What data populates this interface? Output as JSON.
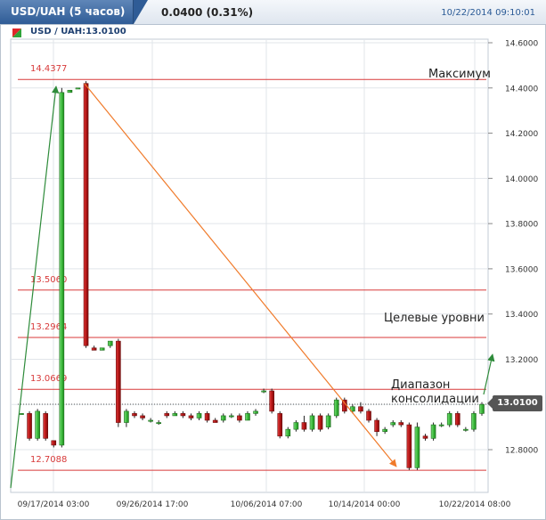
{
  "header": {
    "tab_label": "USD/UAH (5 часов)",
    "change": "0.0400 (0.31%)",
    "datetime": "10/22/2014 09:10:01"
  },
  "chart_data": {
    "type": "candlestick",
    "subtitle": "USD / UAH:13.0100",
    "last_price": "13.0100",
    "ylim": [
      12.68,
      14.68
    ],
    "y_ticks": [
      "12.8000",
      "13.0000",
      "13.2000",
      "13.4000",
      "13.6000",
      "13.8000",
      "14.0000",
      "14.2000",
      "14.4000",
      "14.6000"
    ],
    "x_ticks": [
      "09/17/2014 03:00",
      "09/26/2014 17:00",
      "10/06/2014 07:00",
      "10/14/2014 00:00",
      "10/22/2014 08:00"
    ],
    "levels": [
      {
        "label": "14.4377",
        "value": 14.4377
      },
      {
        "label": "13.5060",
        "value": 13.506
      },
      {
        "label": "13.2964",
        "value": 13.2964
      },
      {
        "label": "13.0669",
        "value": 13.0669
      },
      {
        "label": "12.7088",
        "value": 12.7088
      }
    ],
    "annotations": {
      "max": "Максимум",
      "targets": "Целевые уровни",
      "range_line1": "Диапазон",
      "range_line2": "консолидации"
    },
    "candles": [
      [
        12.96,
        12.96,
        12.96,
        12.96
      ],
      [
        12.96,
        12.97,
        12.84,
        12.85
      ],
      [
        12.85,
        12.98,
        12.84,
        12.97
      ],
      [
        12.96,
        12.97,
        12.84,
        12.85
      ],
      [
        12.84,
        12.84,
        12.81,
        12.82
      ],
      [
        12.82,
        14.4,
        12.81,
        14.38
      ],
      [
        14.38,
        14.39,
        14.38,
        14.39
      ],
      [
        14.4,
        14.4,
        14.4,
        14.4
      ],
      [
        14.42,
        14.43,
        13.25,
        13.26
      ],
      [
        13.25,
        13.26,
        13.24,
        13.24
      ],
      [
        13.24,
        13.25,
        13.24,
        13.25
      ],
      [
        13.26,
        13.28,
        13.25,
        13.28
      ],
      [
        13.28,
        13.29,
        12.9,
        12.92
      ],
      [
        12.92,
        12.98,
        12.9,
        12.97
      ],
      [
        12.96,
        12.97,
        12.94,
        12.95
      ],
      [
        12.95,
        12.96,
        12.93,
        12.94
      ],
      [
        12.93,
        12.94,
        12.92,
        12.93
      ],
      [
        12.92,
        12.93,
        12.91,
        12.92
      ],
      [
        12.96,
        12.97,
        12.94,
        12.95
      ],
      [
        12.95,
        12.97,
        12.95,
        12.96
      ],
      [
        12.96,
        12.97,
        12.94,
        12.95
      ],
      [
        12.95,
        12.96,
        12.93,
        12.94
      ],
      [
        12.94,
        12.97,
        12.93,
        12.96
      ],
      [
        12.96,
        12.97,
        12.92,
        12.93
      ],
      [
        12.93,
        12.94,
        12.92,
        12.92
      ],
      [
        12.93,
        12.96,
        12.92,
        12.95
      ],
      [
        12.95,
        12.96,
        12.94,
        12.95
      ],
      [
        12.95,
        12.96,
        12.92,
        12.93
      ],
      [
        12.93,
        12.97,
        12.93,
        12.96
      ],
      [
        12.96,
        12.98,
        12.95,
        12.97
      ],
      [
        13.06,
        13.07,
        13.05,
        13.06
      ],
      [
        13.06,
        13.07,
        12.96,
        12.97
      ],
      [
        12.96,
        12.97,
        12.85,
        12.86
      ],
      [
        12.86,
        12.9,
        12.85,
        12.89
      ],
      [
        12.89,
        12.93,
        12.88,
        12.92
      ],
      [
        12.92,
        12.95,
        12.88,
        12.89
      ],
      [
        12.89,
        12.96,
        12.88,
        12.95
      ],
      [
        12.95,
        12.96,
        12.88,
        12.89
      ],
      [
        12.9,
        12.96,
        12.89,
        12.95
      ],
      [
        12.95,
        13.03,
        12.94,
        13.02
      ],
      [
        13.02,
        13.03,
        12.96,
        12.97
      ],
      [
        12.97,
        13.0,
        12.96,
        12.99
      ],
      [
        12.99,
        13.01,
        12.96,
        12.97
      ],
      [
        12.97,
        12.98,
        12.92,
        12.93
      ],
      [
        12.93,
        12.94,
        12.86,
        12.88
      ],
      [
        12.88,
        12.9,
        12.87,
        12.89
      ],
      [
        12.91,
        12.93,
        12.9,
        12.92
      ],
      [
        12.92,
        12.93,
        12.9,
        12.91
      ],
      [
        12.91,
        12.92,
        12.71,
        12.72
      ],
      [
        12.72,
        12.92,
        12.71,
        12.9
      ],
      [
        12.86,
        12.87,
        12.84,
        12.85
      ],
      [
        12.85,
        12.92,
        12.84,
        12.91
      ],
      [
        12.91,
        12.92,
        12.9,
        12.91
      ],
      [
        12.91,
        12.97,
        12.9,
        12.96
      ],
      [
        12.96,
        12.97,
        12.9,
        12.91
      ],
      [
        12.89,
        12.9,
        12.88,
        12.89
      ],
      [
        12.89,
        12.97,
        12.88,
        12.96
      ],
      [
        12.96,
        13.01,
        12.95,
        13.0
      ]
    ]
  }
}
